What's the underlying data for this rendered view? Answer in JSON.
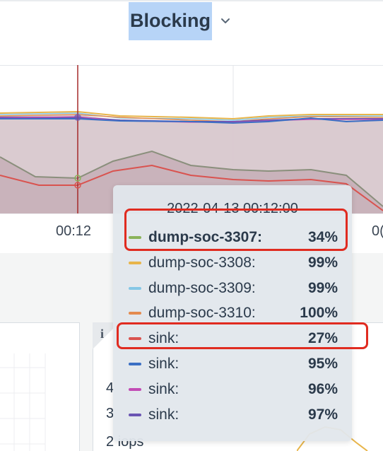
{
  "header": {
    "title": "Blocking"
  },
  "chart": {
    "x_tick_visible": "00:12",
    "x_tick_right_partial": "0("
  },
  "bottom_panel": {
    "info_symbol": "i",
    "y_labels": [
      "4",
      "3",
      "2 iops"
    ]
  },
  "tooltip": {
    "time": "2022-04-13 00:12:00",
    "rows": [
      {
        "name": "dump-soc-3307:",
        "value": "34%",
        "color": "#8ab35a",
        "highlighted": true
      },
      {
        "name": "dump-soc-3308:",
        "value": "99%",
        "color": "#e8b54a",
        "highlighted": false
      },
      {
        "name": "dump-soc-3309:",
        "value": "99%",
        "color": "#85c7e6",
        "highlighted": false
      },
      {
        "name": "dump-soc-3310:",
        "value": "100%",
        "color": "#e48b4f",
        "highlighted": false
      },
      {
        "name": "sink:",
        "value": "27%",
        "color": "#d9534f",
        "highlighted": false
      },
      {
        "name": "sink:",
        "value": "95%",
        "color": "#3b6fc4",
        "highlighted": false
      },
      {
        "name": "sink:",
        "value": "96%",
        "color": "#c24cb5",
        "highlighted": false
      },
      {
        "name": "sink:",
        "value": "97%",
        "color": "#6a55b3",
        "highlighted": false
      }
    ]
  },
  "colors": {
    "accent_selection": "#b7d4f7",
    "annotation_red": "#e02b20",
    "cursor_line": "#a52a2a",
    "area_fill": "#cbb8c0"
  }
}
